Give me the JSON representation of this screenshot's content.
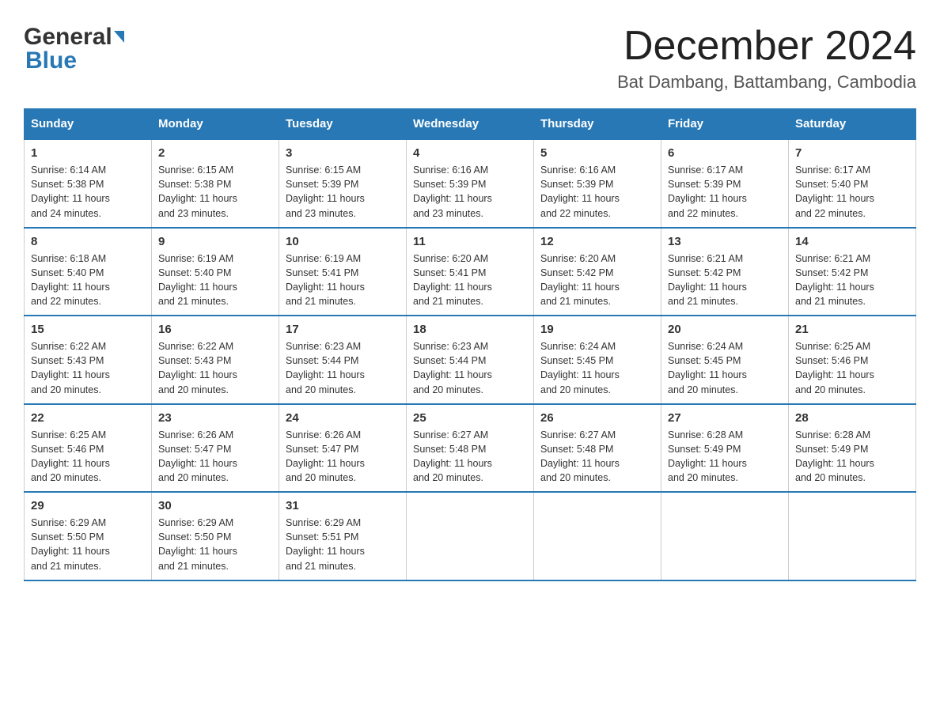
{
  "header": {
    "logo_general": "General",
    "logo_blue": "Blue",
    "month_title": "December 2024",
    "location": "Bat Dambang, Battambang, Cambodia"
  },
  "days_of_week": [
    "Sunday",
    "Monday",
    "Tuesday",
    "Wednesday",
    "Thursday",
    "Friday",
    "Saturday"
  ],
  "weeks": [
    [
      {
        "num": "1",
        "sunrise": "6:14 AM",
        "sunset": "5:38 PM",
        "daylight": "11 hours and 24 minutes."
      },
      {
        "num": "2",
        "sunrise": "6:15 AM",
        "sunset": "5:38 PM",
        "daylight": "11 hours and 23 minutes."
      },
      {
        "num": "3",
        "sunrise": "6:15 AM",
        "sunset": "5:39 PM",
        "daylight": "11 hours and 23 minutes."
      },
      {
        "num": "4",
        "sunrise": "6:16 AM",
        "sunset": "5:39 PM",
        "daylight": "11 hours and 23 minutes."
      },
      {
        "num": "5",
        "sunrise": "6:16 AM",
        "sunset": "5:39 PM",
        "daylight": "11 hours and 22 minutes."
      },
      {
        "num": "6",
        "sunrise": "6:17 AM",
        "sunset": "5:39 PM",
        "daylight": "11 hours and 22 minutes."
      },
      {
        "num": "7",
        "sunrise": "6:17 AM",
        "sunset": "5:40 PM",
        "daylight": "11 hours and 22 minutes."
      }
    ],
    [
      {
        "num": "8",
        "sunrise": "6:18 AM",
        "sunset": "5:40 PM",
        "daylight": "11 hours and 22 minutes."
      },
      {
        "num": "9",
        "sunrise": "6:19 AM",
        "sunset": "5:40 PM",
        "daylight": "11 hours and 21 minutes."
      },
      {
        "num": "10",
        "sunrise": "6:19 AM",
        "sunset": "5:41 PM",
        "daylight": "11 hours and 21 minutes."
      },
      {
        "num": "11",
        "sunrise": "6:20 AM",
        "sunset": "5:41 PM",
        "daylight": "11 hours and 21 minutes."
      },
      {
        "num": "12",
        "sunrise": "6:20 AM",
        "sunset": "5:42 PM",
        "daylight": "11 hours and 21 minutes."
      },
      {
        "num": "13",
        "sunrise": "6:21 AM",
        "sunset": "5:42 PM",
        "daylight": "11 hours and 21 minutes."
      },
      {
        "num": "14",
        "sunrise": "6:21 AM",
        "sunset": "5:42 PM",
        "daylight": "11 hours and 21 minutes."
      }
    ],
    [
      {
        "num": "15",
        "sunrise": "6:22 AM",
        "sunset": "5:43 PM",
        "daylight": "11 hours and 20 minutes."
      },
      {
        "num": "16",
        "sunrise": "6:22 AM",
        "sunset": "5:43 PM",
        "daylight": "11 hours and 20 minutes."
      },
      {
        "num": "17",
        "sunrise": "6:23 AM",
        "sunset": "5:44 PM",
        "daylight": "11 hours and 20 minutes."
      },
      {
        "num": "18",
        "sunrise": "6:23 AM",
        "sunset": "5:44 PM",
        "daylight": "11 hours and 20 minutes."
      },
      {
        "num": "19",
        "sunrise": "6:24 AM",
        "sunset": "5:45 PM",
        "daylight": "11 hours and 20 minutes."
      },
      {
        "num": "20",
        "sunrise": "6:24 AM",
        "sunset": "5:45 PM",
        "daylight": "11 hours and 20 minutes."
      },
      {
        "num": "21",
        "sunrise": "6:25 AM",
        "sunset": "5:46 PM",
        "daylight": "11 hours and 20 minutes."
      }
    ],
    [
      {
        "num": "22",
        "sunrise": "6:25 AM",
        "sunset": "5:46 PM",
        "daylight": "11 hours and 20 minutes."
      },
      {
        "num": "23",
        "sunrise": "6:26 AM",
        "sunset": "5:47 PM",
        "daylight": "11 hours and 20 minutes."
      },
      {
        "num": "24",
        "sunrise": "6:26 AM",
        "sunset": "5:47 PM",
        "daylight": "11 hours and 20 minutes."
      },
      {
        "num": "25",
        "sunrise": "6:27 AM",
        "sunset": "5:48 PM",
        "daylight": "11 hours and 20 minutes."
      },
      {
        "num": "26",
        "sunrise": "6:27 AM",
        "sunset": "5:48 PM",
        "daylight": "11 hours and 20 minutes."
      },
      {
        "num": "27",
        "sunrise": "6:28 AM",
        "sunset": "5:49 PM",
        "daylight": "11 hours and 20 minutes."
      },
      {
        "num": "28",
        "sunrise": "6:28 AM",
        "sunset": "5:49 PM",
        "daylight": "11 hours and 20 minutes."
      }
    ],
    [
      {
        "num": "29",
        "sunrise": "6:29 AM",
        "sunset": "5:50 PM",
        "daylight": "11 hours and 21 minutes."
      },
      {
        "num": "30",
        "sunrise": "6:29 AM",
        "sunset": "5:50 PM",
        "daylight": "11 hours and 21 minutes."
      },
      {
        "num": "31",
        "sunrise": "6:29 AM",
        "sunset": "5:51 PM",
        "daylight": "11 hours and 21 minutes."
      },
      null,
      null,
      null,
      null
    ]
  ],
  "labels": {
    "sunrise": "Sunrise:",
    "sunset": "Sunset:",
    "daylight": "Daylight:"
  }
}
